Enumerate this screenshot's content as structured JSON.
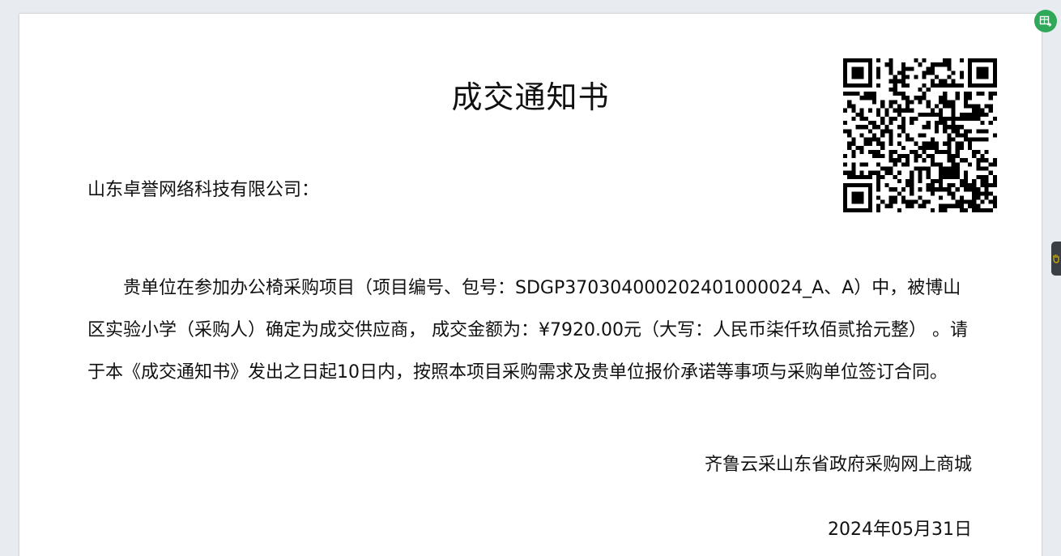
{
  "document": {
    "title": "成交通知书",
    "recipient": "山东卓誉网络科技有限公司：",
    "body": "贵单位在参加办公椅采购项目（项目编号、包号：SDGP370304000202401000024_A、A）中，被博山区实验小学（采购人）确定为成交供应商， 成交金额为：¥7920.00元（大写：人民币柒仟玖佰贰拾元整） 。请于本《成交通知书》发出之日起10日内，按照本项目采购需求及贵单位报价承诺等事项与采购单位签订合同。",
    "signer": "齐鲁云采山东省政府采购网上商城",
    "date": "2024年05月31日"
  },
  "icons": {
    "qr": "qr-code",
    "corner_button": "table-export-icon",
    "side_tab": "hand-icon"
  },
  "colors": {
    "corner_button": "#2fa85a",
    "side_tab": "#3a3f45",
    "page": "#ffffff",
    "background": "#e8ebef"
  }
}
